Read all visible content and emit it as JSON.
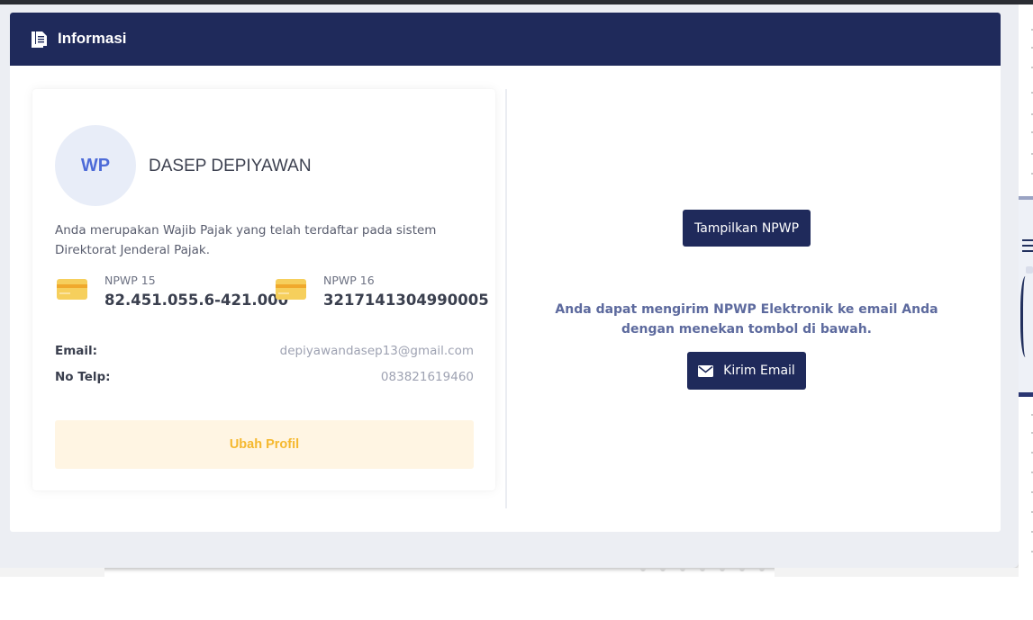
{
  "header": {
    "title": "Informasi",
    "icon": "document-copy-icon"
  },
  "profile": {
    "avatar_initials": "WP",
    "name": "DASEP DEPIYAWAN",
    "description": "Anda merupakan Wajib Pajak yang telah terdaftar pada sistem Direktorat Jenderal Pajak.",
    "npwp15": {
      "label": "NPWP 15",
      "value": "82.451.055.6-421.000",
      "icon": "credit-card-icon"
    },
    "npwp16": {
      "label": "NPWP 16",
      "value": "3217141304990005",
      "icon": "credit-card-icon"
    },
    "email": {
      "label": "Email:",
      "value": "depiyawandasep13@gmail.com"
    },
    "phone": {
      "label": "No Telp:",
      "value": "083821619460"
    },
    "edit_button": "Ubah Profil"
  },
  "actions": {
    "show_npwp_button": "Tampilkan NPWP",
    "note": "Anda dapat mengirim NPWP Elektronik ke email Anda dengan menekan tombol di bawah.",
    "send_email_button": "Kirim Email",
    "send_email_icon": "envelope-icon"
  },
  "colors": {
    "header_bg": "#1f2a5b",
    "primary_button": "#1f2a5b",
    "avatar_bg": "#e8edf8",
    "avatar_text": "#4d6bd8",
    "warning_bg": "#fff5e3",
    "warning_text": "#f5b82e",
    "card_icon": "#f6cf5c"
  }
}
